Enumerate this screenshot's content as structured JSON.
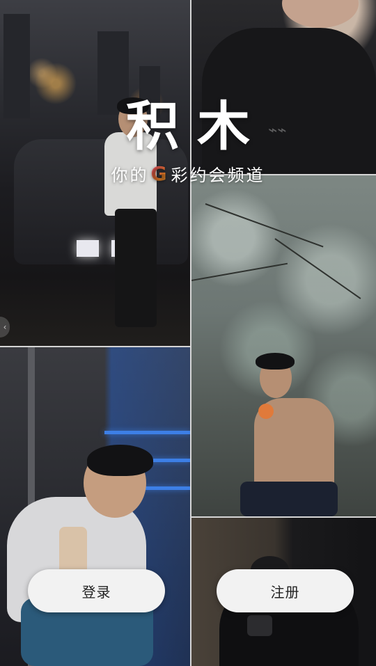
{
  "app": {
    "title": "积木",
    "tagline_before": "你的",
    "tagline_logo": "G",
    "tagline_after": "彩约会频道"
  },
  "actions": {
    "login_label": "登录",
    "register_label": "注册"
  },
  "colors": {
    "button_bg": "#f2f2f2",
    "button_text": "#222222",
    "title_text": "#ffffff",
    "logo_gradient_start": "#ff3f7e",
    "logo_gradient_end": "#ffb23a"
  }
}
